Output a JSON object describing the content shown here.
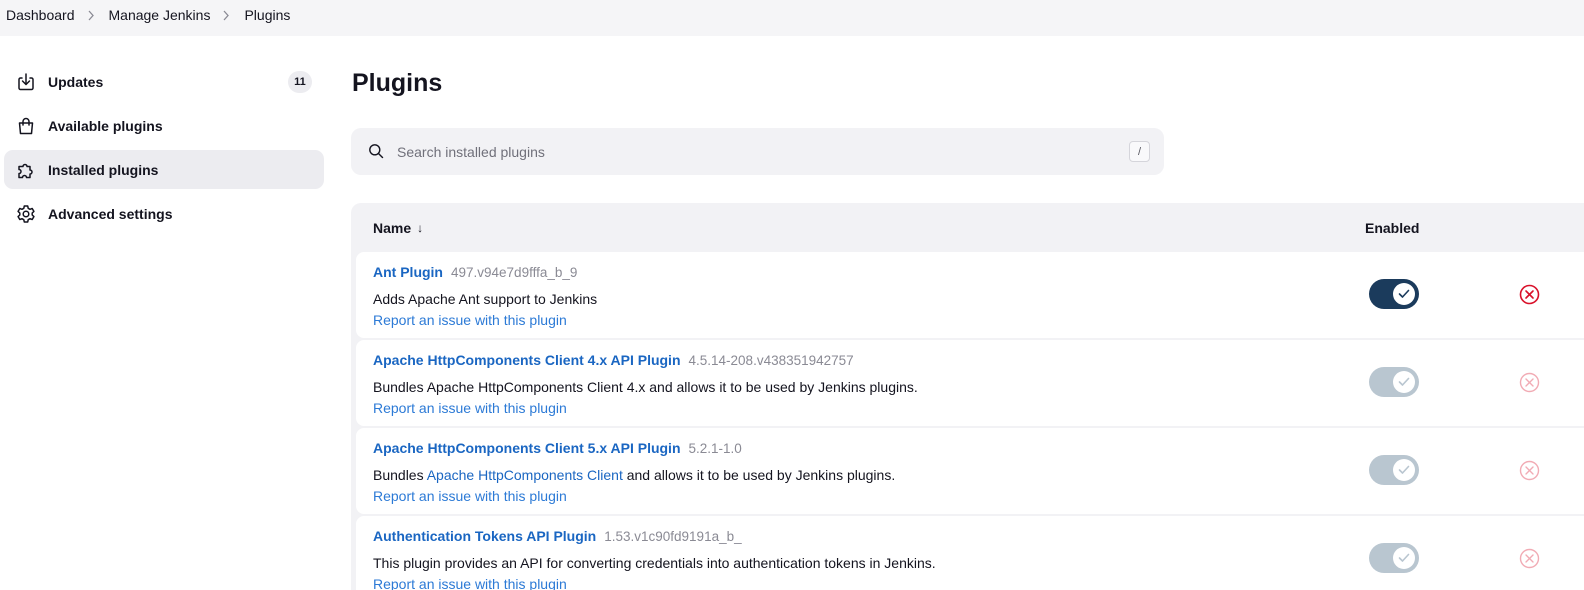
{
  "breadcrumb": [
    "Dashboard",
    "Manage Jenkins",
    "Plugins"
  ],
  "sidebar": {
    "items": [
      {
        "label": "Updates",
        "badge": "11",
        "icon": "download-icon"
      },
      {
        "label": "Available plugins",
        "icon": "shopping-bag-icon"
      },
      {
        "label": "Installed plugins",
        "icon": "puzzle-icon",
        "active": true
      },
      {
        "label": "Advanced settings",
        "icon": "gear-icon"
      }
    ]
  },
  "main": {
    "title": "Plugins",
    "search": {
      "placeholder": "Search installed plugins",
      "shortcut": "/"
    },
    "table": {
      "headers": {
        "name": "Name",
        "sort_arrow": "↓",
        "enabled": "Enabled"
      },
      "rows": [
        {
          "name": "Ant Plugin",
          "version": "497.v94e7d9fffa_b_9",
          "description": "Adds Apache Ant support to Jenkins",
          "report": "Report an issue with this plugin",
          "enabled": true,
          "toggle_state": "on"
        },
        {
          "name": "Apache HttpComponents Client 4.x API Plugin",
          "version": "4.5.14-208.v438351942757",
          "description": "Bundles Apache HttpComponents Client 4.x and allows it to be used by Jenkins plugins.",
          "report": "Report an issue with this plugin",
          "enabled": true,
          "toggle_state": "disabled"
        },
        {
          "name": "Apache HttpComponents Client 5.x API Plugin",
          "version": "5.2.1-1.0",
          "description_pre": "Bundles ",
          "description_link": "Apache HttpComponents Client",
          "description_post": " and allows it to be used by Jenkins plugins.",
          "report": "Report an issue with this plugin",
          "enabled": true,
          "toggle_state": "disabled"
        },
        {
          "name": "Authentication Tokens API Plugin",
          "version": "1.53.v1c90fd9191a_b_",
          "description": "This plugin provides an API for converting credentials into authentication tokens in Jenkins.",
          "report": "Report an issue with this plugin",
          "enabled": true,
          "toggle_state": "disabled"
        }
      ]
    }
  },
  "colors": {
    "link": "#1a66c2",
    "toggle_on": "#1b3b5c",
    "toggle_disabled": "#b9c6d0",
    "danger": "#d9112a"
  }
}
